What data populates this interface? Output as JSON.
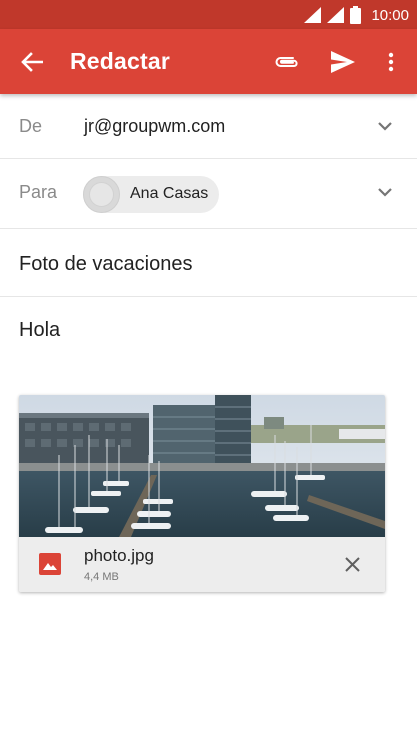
{
  "status_bar": {
    "time": "10:00"
  },
  "toolbar": {
    "title": "Redactar",
    "back_icon": "arrow-back-icon",
    "attach_icon": "paperclip-icon",
    "send_icon": "send-icon",
    "more_icon": "more-vert-icon",
    "accent_color": "#db4437",
    "status_color": "#c0382b"
  },
  "from": {
    "label": "De",
    "value": "jr@groupwm.com"
  },
  "to": {
    "label": "Para",
    "recipients": [
      {
        "name": "Ana Casas"
      }
    ]
  },
  "subject": {
    "value": "Foto de vacaciones"
  },
  "body": {
    "text": "Hola"
  },
  "attachment": {
    "file_name": "photo.jpg",
    "file_size": "4,4 MB",
    "type_icon": "image-icon",
    "remove_icon": "close-icon"
  }
}
